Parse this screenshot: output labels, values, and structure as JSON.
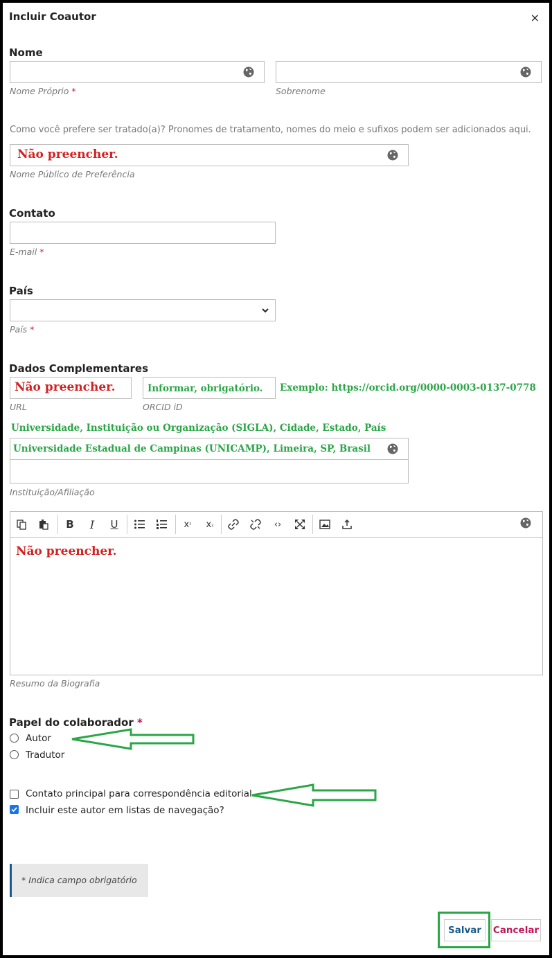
{
  "dialog": {
    "title": "Incluir Coautor",
    "close": "×"
  },
  "nome": {
    "heading": "Nome",
    "first_label": "Nome Próprio",
    "last_label": "Sobrenome",
    "required_mark": "*"
  },
  "preferred": {
    "help": "Como você prefere ser tratado(a)? Pronomes de tratamento, nomes do meio e sufixos podem ser adicionados aqui.",
    "value": "Não preencher.",
    "label": "Nome Público de Preferência"
  },
  "contato": {
    "heading": "Contato",
    "email_label": "E-mail",
    "required_mark": "*"
  },
  "pais": {
    "heading": "País",
    "label": "País",
    "required_mark": "*"
  },
  "dados": {
    "heading": "Dados Complementares",
    "url_value": "Não preencher.",
    "url_label": "URL",
    "orcid_value": "Informar, obrigatório.",
    "orcid_label": "ORCID iD",
    "orcid_example": "Exemplo: https://orcid.org/0000-0003-0137-0778",
    "affil_hint": "Universidade, Instituição ou Organização (SIGLA), Cidade, Estado, País",
    "affil_value": "Universidade Estadual de Campinas (UNICAMP), Limeira, SP, Brasil",
    "affil_label": "Instituição/Afiliação"
  },
  "bio": {
    "value": "Não preencher.",
    "label": "Resumo da Biografia"
  },
  "papel": {
    "heading": "Papel do colaborador",
    "required_mark": "*",
    "options": [
      "Autor",
      "Tradutor"
    ]
  },
  "checks": {
    "primary_contact": "Contato principal para correspondência editorial.",
    "include_browse": "Incluir este autor em listas de navegação?"
  },
  "notice": "* Indica campo obrigatório",
  "buttons": {
    "save": "Salvar",
    "cancel": "Cancelar"
  },
  "colors": {
    "accent_red": "#d42020",
    "accent_green": "#2aa646",
    "required": "#c0185b",
    "save_blue": "#1a5a8a"
  }
}
